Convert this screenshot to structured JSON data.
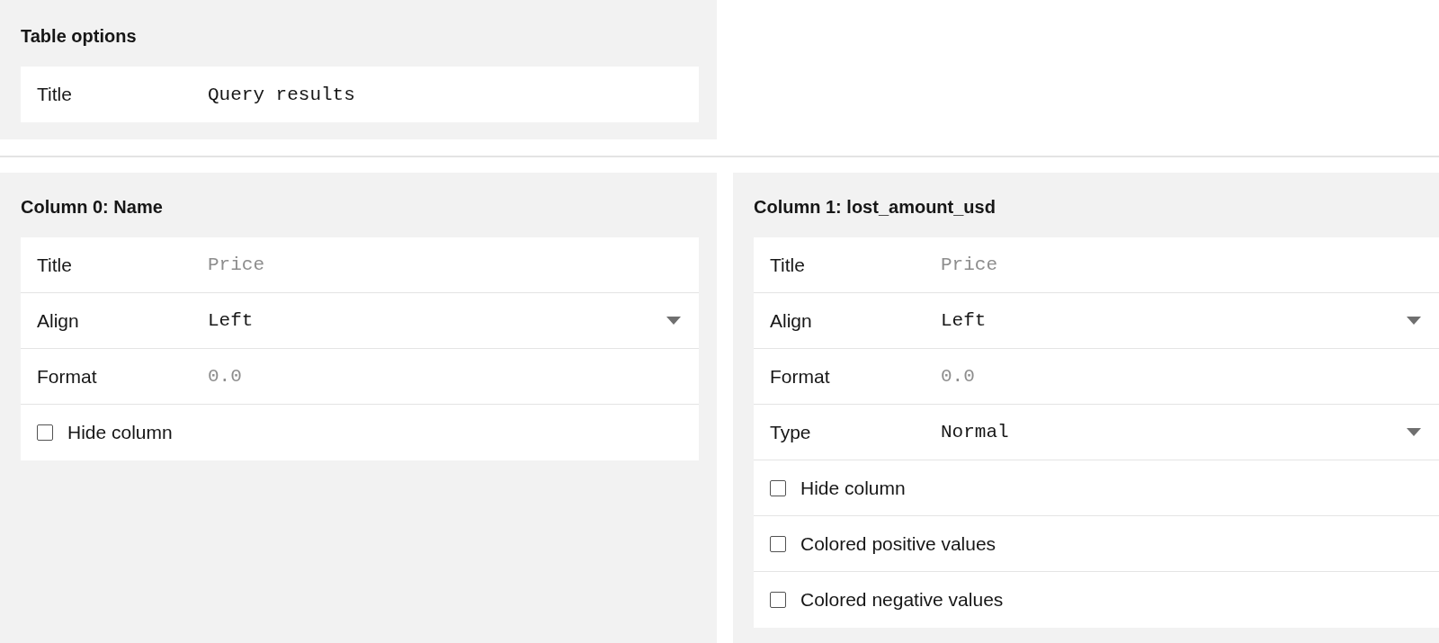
{
  "table_options": {
    "heading": "Table options",
    "fields": [
      {
        "kind": "text",
        "label": "Title",
        "value": "Query results"
      }
    ]
  },
  "columns": [
    {
      "heading": "Column 0: Name",
      "fields": [
        {
          "kind": "text",
          "label": "Title",
          "placeholder": "Price"
        },
        {
          "kind": "select",
          "label": "Align",
          "value": "Left"
        },
        {
          "kind": "text",
          "label": "Format",
          "placeholder": "0.0"
        },
        {
          "kind": "checkbox",
          "label": "Hide column",
          "checked": false
        }
      ]
    },
    {
      "heading": "Column 1: lost_amount_usd",
      "fields": [
        {
          "kind": "text",
          "label": "Title",
          "placeholder": "Price"
        },
        {
          "kind": "select",
          "label": "Align",
          "value": "Left"
        },
        {
          "kind": "text",
          "label": "Format",
          "placeholder": "0.0"
        },
        {
          "kind": "select",
          "label": "Type",
          "value": "Normal"
        },
        {
          "kind": "checkbox",
          "label": "Hide column",
          "checked": false
        },
        {
          "kind": "checkbox",
          "label": "Colored positive values",
          "checked": false
        },
        {
          "kind": "checkbox",
          "label": "Colored negative values",
          "checked": false
        }
      ]
    }
  ]
}
